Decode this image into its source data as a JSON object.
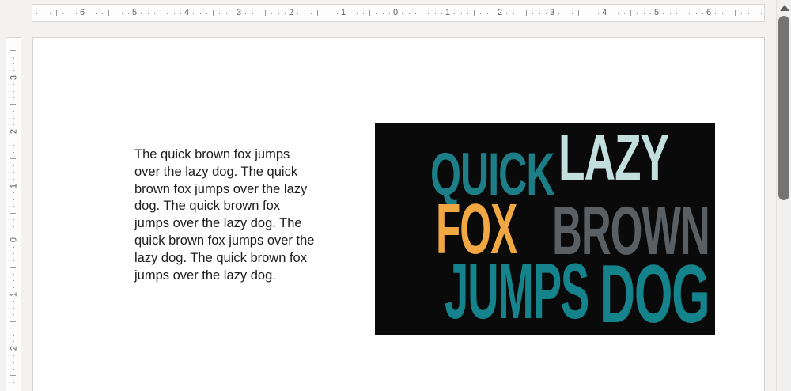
{
  "rulers": {
    "horizontal": {
      "numbers": [
        "6",
        "5",
        "4",
        "3",
        "2",
        "1",
        "0",
        "1",
        "2",
        "3",
        "4",
        "5",
        "6"
      ]
    },
    "vertical": {
      "numbers": [
        "3",
        "2",
        "1",
        "0",
        "1",
        "2"
      ]
    }
  },
  "document": {
    "paragraph_lines": [
      "The quick brown fox jumps",
      "over the lazy dog. The quick",
      "brown fox jumps over the lazy",
      "dog. The quick brown fox",
      "jumps over the lazy dog. The",
      "quick brown fox jumps over the",
      "lazy dog. The quick brown fox",
      "jumps over the lazy dog."
    ]
  },
  "wordart": {
    "background_color": "#0a0a0a",
    "words": [
      {
        "text": "QUICK",
        "color": "#1e7e88"
      },
      {
        "text": "LAZY",
        "color": "#c2dedd"
      },
      {
        "text": "FOX",
        "color": "#f1a742"
      },
      {
        "text": "BROWN",
        "color": "#595f62"
      },
      {
        "text": "JUMPS",
        "color": "#15838b"
      },
      {
        "text": "DOG",
        "color": "#15838b"
      }
    ]
  },
  "scrollbar": {
    "up_icon": "triangle-up"
  }
}
